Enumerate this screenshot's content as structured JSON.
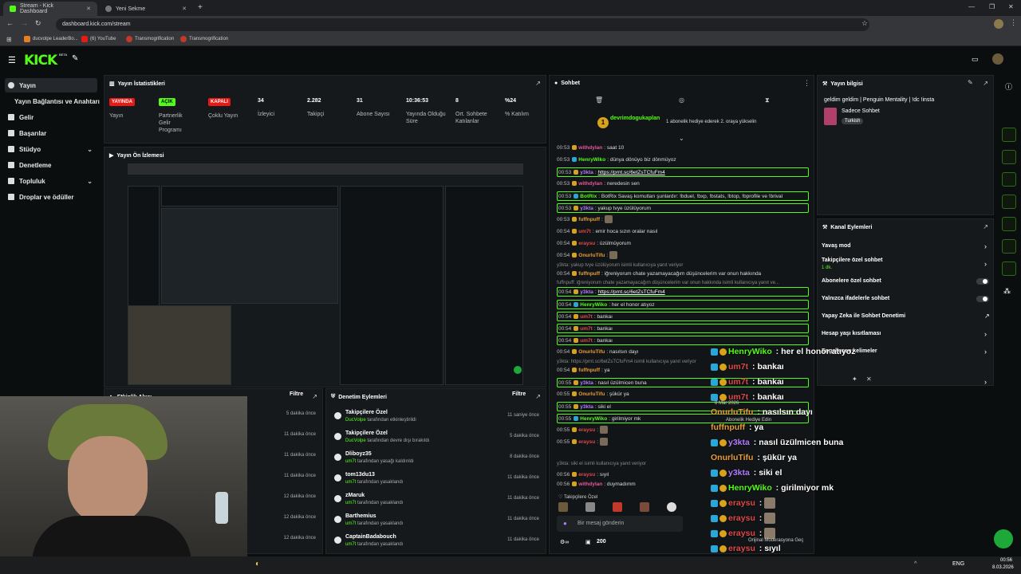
{
  "browser": {
    "tabs": [
      {
        "title": "Stream - Kick Dashboard",
        "active": true
      },
      {
        "title": "Yeni Sekme",
        "active": false
      }
    ],
    "url": "dashboard.kick.com/stream",
    "bookmarks": [
      "ducvolpe LeaderBo...",
      "(6) YouTube",
      "Transmogrification",
      "Transmogrification"
    ]
  },
  "header": {
    "logo": "KICK",
    "logo_tag": "BETA"
  },
  "sidebar": {
    "items": [
      {
        "label": "Yayın",
        "active": true,
        "chevron": false
      },
      {
        "label": "Yayın Bağlantısı ve Anahtarı",
        "active": false,
        "chevron": false
      },
      {
        "label": "Gelir",
        "active": false,
        "chevron": false
      },
      {
        "label": "Başarılar",
        "active": false,
        "chevron": false
      },
      {
        "label": "Stüdyo",
        "active": false,
        "chevron": true
      },
      {
        "label": "Denetleme",
        "active": false,
        "chevron": false
      },
      {
        "label": "Topluluk",
        "active": false,
        "chevron": true
      },
      {
        "label": "Droplar ve ödüller",
        "active": false,
        "chevron": false
      }
    ]
  },
  "stats": {
    "title": "Yayın İstatistikleri",
    "items": [
      {
        "value": "YAYINDA",
        "label": "Yayın",
        "kind": "red"
      },
      {
        "value": "AÇIK",
        "label": "Partnerlik Gelir Programı",
        "kind": "green"
      },
      {
        "value": "KAPALI",
        "label": "Çoklu Yayın",
        "kind": "red"
      },
      {
        "value": "34",
        "label": "İzleyici",
        "kind": "text"
      },
      {
        "value": "2.282",
        "label": "Takipçi",
        "kind": "text"
      },
      {
        "value": "31",
        "label": "Abone Sayısı",
        "kind": "text"
      },
      {
        "value": "10:36:53",
        "label": "Yayında Olduğu Süre",
        "kind": "text"
      },
      {
        "value": "8",
        "label": "Ort. Sohbete Katılanlar",
        "kind": "text"
      },
      {
        "value": "%24",
        "label": "% Katılım",
        "kind": "text"
      }
    ]
  },
  "preview": {
    "title": "Yayın Ön İzlemesi"
  },
  "activity": {
    "title": "Etkinlik Akışı",
    "filter": "Filtre",
    "times": [
      "5 dakika önce",
      "11 dakika önce",
      "11 dakika önce",
      "11 dakika önce",
      "12 dakika önce",
      "12 dakika önce",
      "12 dakika önce"
    ]
  },
  "moderation": {
    "title": "Denetim Eylemleri",
    "filter": "Filtre",
    "rows": [
      {
        "name": "Takipçilere Özel",
        "actor": "DucVolpe",
        "desc": "tarafından etkinleştirildi",
        "time": "11 saniye önce",
        "icon": "heart-icon"
      },
      {
        "name": "Takipçilere Özel",
        "actor": "DucVolpe",
        "desc": "tarafından devre dışı bırakıldı",
        "time": "5 dakika önce",
        "icon": "heart-icon"
      },
      {
        "name": "Dliboyz35",
        "actor": "um7t",
        "desc": "tarafından yasağı kaldırıldı",
        "time": "8 dakika önce",
        "icon": "undo-icon"
      },
      {
        "name": "tom13du13",
        "actor": "um7t",
        "desc": "tarafından yasaklandı",
        "time": "11 dakika önce",
        "icon": "ban-icon"
      },
      {
        "name": "zMaruk",
        "actor": "um7t",
        "desc": "tarafından yasaklandı",
        "time": "11 dakika önce",
        "icon": "ban-icon"
      },
      {
        "name": "Barthemius",
        "actor": "um7t",
        "desc": "tarafından yasaklandı",
        "time": "11 dakika önce",
        "icon": "ban-icon"
      },
      {
        "name": "CaptainBadabouch",
        "actor": "um7t",
        "desc": "tarafından yasaklandı",
        "time": "11 dakika önce",
        "icon": "ban-icon"
      }
    ]
  },
  "chat": {
    "title": "Sohbet",
    "pinned_user": "devrimdogukaplan",
    "pinned_text": "1 abonelik hediye ederek 2. oraya yükselin",
    "lines": [
      {
        "ts": "00:53",
        "user": "withdylan",
        "color": "pk",
        "text": "saat 10",
        "boxed": false
      },
      {
        "ts": "00:53",
        "user": "HenryWiko",
        "color": "gr",
        "text": "dünya dönüyo biz dönmüyoz",
        "boxed": false
      },
      {
        "ts": "00:53",
        "user": "y3kta",
        "color": "pu",
        "text": "https://prnt.sc/6etZsTCfuFm4",
        "boxed": true,
        "link": true
      },
      {
        "ts": "00:53",
        "user": "withdylan",
        "color": "pk",
        "text": "neredesin sen",
        "boxed": false
      },
      {
        "ts": "00:53",
        "user": "BotRix",
        "color": "gr",
        "text": "BotRix Savaş komutları şunlardır: !bduel, !bxp, !bstats, !btop, !bprofile ve !brival",
        "boxed": true
      },
      {
        "ts": "00:53",
        "user": "y3kta",
        "color": "pu",
        "text": "yakup tvye üzülüyorum",
        "boxed": true
      },
      {
        "ts": "00:53",
        "user": "fuffnpuff",
        "color": "or",
        "text": "",
        "boxed": false
      },
      {
        "ts": "00:54",
        "user": "um7t",
        "color": "rd",
        "text": "emir hoca sızın oralar nasıl",
        "boxed": false
      },
      {
        "ts": "00:54",
        "user": "eraysu",
        "color": "rd",
        "text": "üzülmüyorum",
        "boxed": false
      },
      {
        "ts": "00:54",
        "user": "OnurluTifu",
        "color": "or",
        "text": "",
        "boxed": false
      },
      {
        "ts": "00:54",
        "user": "fuffnpuff",
        "color": "or",
        "text": "iğreniyorum chate yazamayacağım düşüncelerim var onun hakkında",
        "boxed": false
      },
      {
        "ts": "00:54",
        "user": "y3kta",
        "color": "pu",
        "text": "https://prnt.sc/6etZsTCfuFm4",
        "boxed": true,
        "link": true
      },
      {
        "ts": "00:54",
        "user": "HenryWiko",
        "color": "gr",
        "text": "her el honor atıyoz",
        "boxed": true
      },
      {
        "ts": "00:54",
        "user": "um7t",
        "color": "rd",
        "text": "bankaı",
        "boxed": true
      },
      {
        "ts": "00:54",
        "user": "um7t",
        "color": "rd",
        "text": "bankaı",
        "boxed": true
      },
      {
        "ts": "00:54",
        "user": "um7t",
        "color": "rd",
        "text": "bankaı",
        "boxed": true
      },
      {
        "ts": "00:54",
        "user": "OnurluTifu",
        "color": "or",
        "text": "nasılsın dayı",
        "boxed": false
      },
      {
        "ts": "00:54",
        "user": "fuffnpuff",
        "color": "or",
        "text": "ya",
        "boxed": false
      },
      {
        "ts": "00:55",
        "user": "y3kta",
        "color": "pu",
        "text": "nasıl üzülmicen buna",
        "boxed": true
      },
      {
        "ts": "00:55",
        "user": "OnurluTifu",
        "color": "or",
        "text": "şükür ya",
        "boxed": false
      },
      {
        "ts": "00:55",
        "user": "y3kta",
        "color": "pu",
        "text": "siki el",
        "boxed": true
      },
      {
        "ts": "00:55",
        "user": "HenryWiko",
        "color": "gr",
        "text": "girilmiyor mk",
        "boxed": true
      },
      {
        "ts": "00:55",
        "user": "eraysu",
        "color": "rd",
        "text": "",
        "boxed": false
      },
      {
        "ts": "00:55",
        "user": "eraysu",
        "color": "rd",
        "text": "",
        "boxed": false
      },
      {
        "ts": "00:56",
        "user": "eraysu",
        "color": "rd",
        "text": "sıyıl",
        "boxed": false
      },
      {
        "ts": "00:56",
        "user": "withdylan",
        "color": "pk",
        "text": "duymadımm",
        "boxed": false
      }
    ],
    "replies": [
      "y3kta: yakup tvye üzülüyorum isimli kullanıcıya yanıt veriyor",
      "fuffnpuff: iğreniyorum chate yazamayacağım düşüncelerim var onun hakkında isimli kullanıcıya yanıt ve...",
      "y3kta: https://prnt.sc/6etZsTCfuFm4 isimli kullanıcıya yanıt veriyor",
      "y3kta: siki el isimli kullanıcıya yanıt veriyor"
    ],
    "followers_only": "Takipçilere Özel",
    "input_placeholder": "Bir mesaj gönderin",
    "points": "200"
  },
  "overlay_chat": [
    {
      "user": "HenryWiko",
      "color": "gr",
      "text": "her el honor atıyoz"
    },
    {
      "user": "um7t",
      "color": "rd",
      "text": "bankaı"
    },
    {
      "user": "um7t",
      "color": "rd",
      "text": "bankaı"
    },
    {
      "user": "um7t",
      "color": "rd",
      "text": "bankaı"
    },
    {
      "user": "OnurluTifu",
      "color": "or",
      "text": "nasılsın dayı"
    },
    {
      "user": "fuffnpuff",
      "color": "or",
      "text": "ya"
    },
    {
      "user": "y3kta",
      "color": "pu",
      "text": "nasıl üzülmicen buna"
    },
    {
      "user": "OnurluTifu",
      "color": "or",
      "text": "şükür ya"
    },
    {
      "user": "y3kta",
      "color": "pu",
      "text": "siki el"
    },
    {
      "user": "HenryWiko",
      "color": "gr",
      "text": "girilmiyor mk"
    },
    {
      "user": "eraysu",
      "color": "rd",
      "text": ""
    },
    {
      "user": "eraysu",
      "color": "rd",
      "text": ""
    },
    {
      "user": "eraysu",
      "color": "rd",
      "text": ""
    },
    {
      "user": "eraysu",
      "color": "rd",
      "text": "sıyıl"
    },
    {
      "user": "withdylan",
      "color": "pk",
      "text": "duymadımm"
    }
  ],
  "overlay_misc": {
    "date": "8 Mar 2026",
    "gift": "Abonelik Hediye Edin",
    "original": "Orijinal Moderasyona Geç",
    "orig_gerek": "gerek"
  },
  "stream_info": {
    "title": "Yayın bilgisi",
    "stream_title": "geldim geldim | Penguin Mentality | !dc !insta",
    "category": "Sadece Sohbet",
    "language": "Turkish"
  },
  "channel_actions": {
    "title": "Kanal Eylemleri",
    "items": [
      {
        "label": "Yavaş mod",
        "control": "arrow"
      },
      {
        "label": "Takipçilere özel sohbet",
        "sub": "1 dk.",
        "control": "arrow"
      },
      {
        "label": "Abonelere özel sohbet",
        "control": "toggle"
      },
      {
        "label": "Yalnızca ifadelerle sohbet",
        "control": "toggle"
      },
      {
        "label": "Yapay Zeka ile Sohbet Denetimi",
        "control": "external"
      },
      {
        "label": "Hesap yaşı kısıtlaması",
        "control": "arrow"
      },
      {
        "label": "Engellenen kelimeler",
        "control": "arrow"
      }
    ]
  },
  "taskbar": {
    "lang": "ENG",
    "time": "00:56",
    "date": "8.03.2026"
  },
  "colors": {
    "accent": "#53fc18",
    "live": "#e91916",
    "bg": "#0b0e0f",
    "panel": "#16191c"
  }
}
